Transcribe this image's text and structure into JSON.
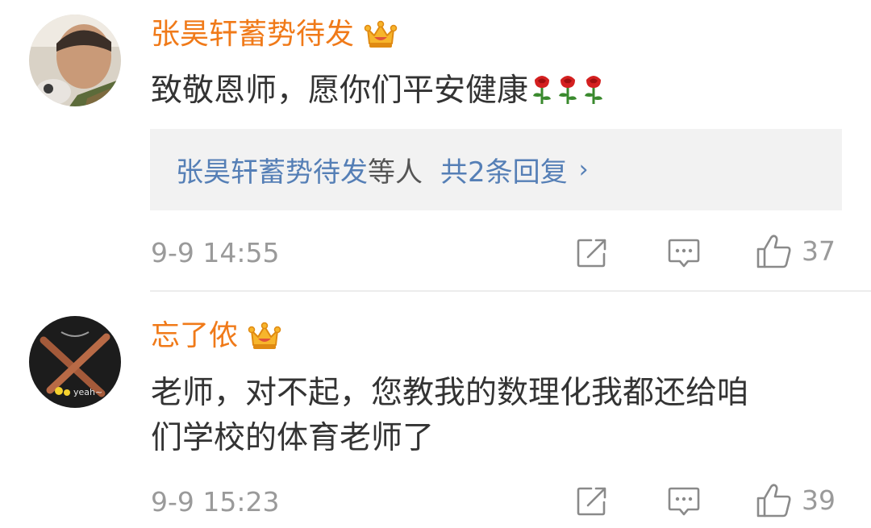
{
  "comments": [
    {
      "username": "张昊轩蓄势待发",
      "badge_icon": "vip-crown-icon",
      "text": "致敬恩师，愿你们平安健康",
      "emoji": [
        "rose-emoji",
        "rose-emoji",
        "rose-emoji"
      ],
      "reply_preview": {
        "user": "张昊轩蓄势待发",
        "others": "等人",
        "count_label": "共2条回复",
        "chevron": "›"
      },
      "time": "9-9 14:55",
      "like_count": "37"
    },
    {
      "username": "忘了侬",
      "badge_icon": "vip-crown-icon",
      "text_line1": "老师，对不起，您教我的数理化我都还给咱",
      "text_line2": "们学校的体育老师了",
      "avatar_text": "yeah~",
      "time": "9-9 15:23",
      "like_count": "39"
    }
  ],
  "icons": {
    "share": "share-icon",
    "comment": "comment-icon",
    "like": "thumbs-up-icon"
  },
  "colors": {
    "username": "#f07a19",
    "link": "#557fb6",
    "meta": "#9a9a9a",
    "reply_bg": "#f2f2f2"
  }
}
